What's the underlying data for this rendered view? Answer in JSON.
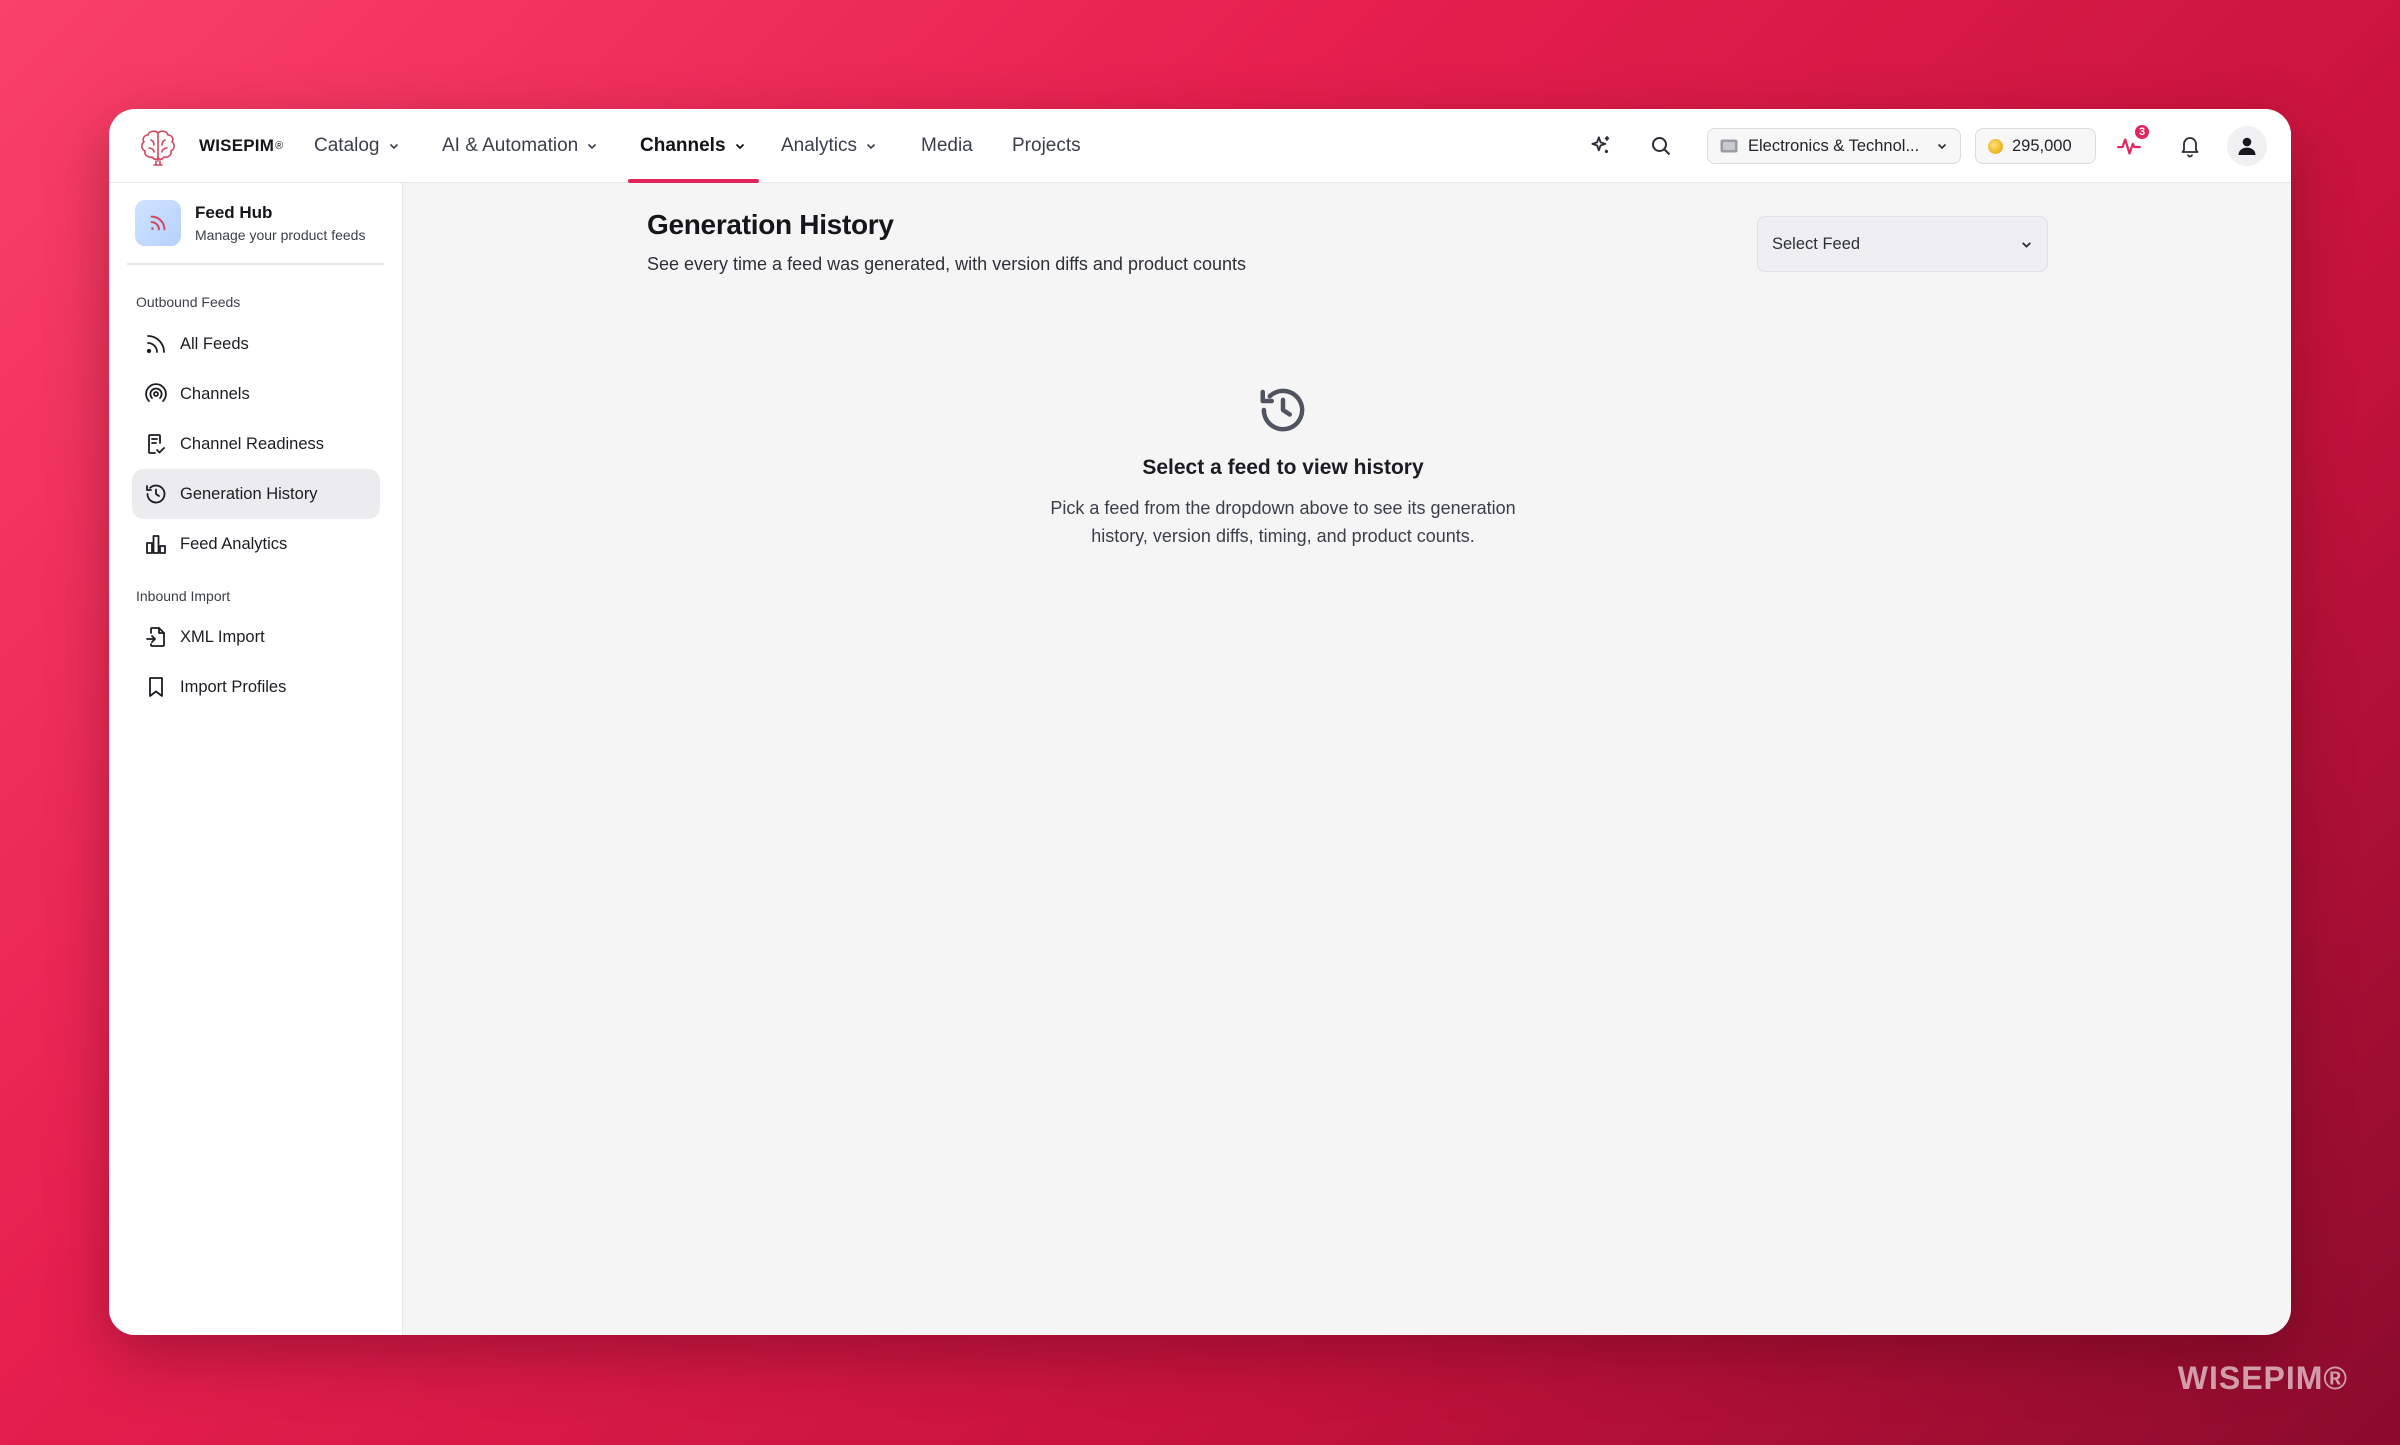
{
  "brand": {
    "name": "WISEPIM",
    "reg": "®"
  },
  "nav": {
    "items": [
      {
        "label": "Catalog",
        "has_menu": true
      },
      {
        "label": "AI & Automation",
        "has_menu": true
      },
      {
        "label": "Channels",
        "has_menu": true,
        "active": true
      },
      {
        "label": "Analytics",
        "has_menu": true
      },
      {
        "label": "Media",
        "has_menu": false
      },
      {
        "label": "Projects",
        "has_menu": false
      }
    ]
  },
  "topbar": {
    "workspace_label": "Electronics & Technol...",
    "credits": "295,000",
    "activity_badge": "3"
  },
  "sidebar": {
    "hub_title": "Feed Hub",
    "hub_subtitle": "Manage your product feeds",
    "sections": [
      {
        "label": "Outbound Feeds",
        "items": [
          {
            "label": "All Feeds",
            "icon": "rss-icon"
          },
          {
            "label": "Channels",
            "icon": "broadcast-icon"
          },
          {
            "label": "Channel Readiness",
            "icon": "checklist-icon"
          },
          {
            "label": "Generation History",
            "icon": "history-icon",
            "active": true
          },
          {
            "label": "Feed Analytics",
            "icon": "bar-chart-icon"
          }
        ]
      },
      {
        "label": "Inbound Import",
        "items": [
          {
            "label": "XML Import",
            "icon": "file-import-icon"
          },
          {
            "label": "Import Profiles",
            "icon": "bookmark-icon"
          }
        ]
      }
    ]
  },
  "main": {
    "title": "Generation History",
    "subtitle": "See every time a feed was generated, with version diffs and product counts",
    "feed_select_label": "Select Feed",
    "empty_title": "Select a feed to view history",
    "empty_description": "Pick a feed from the dropdown above to see its generation history, version diffs, timing, and product counts."
  },
  "watermark": "WISEPIM®",
  "colors": {
    "accent": "#e3245a",
    "background_gradient_start": "#f9416a",
    "background_gradient_end": "#8a0b2c"
  }
}
